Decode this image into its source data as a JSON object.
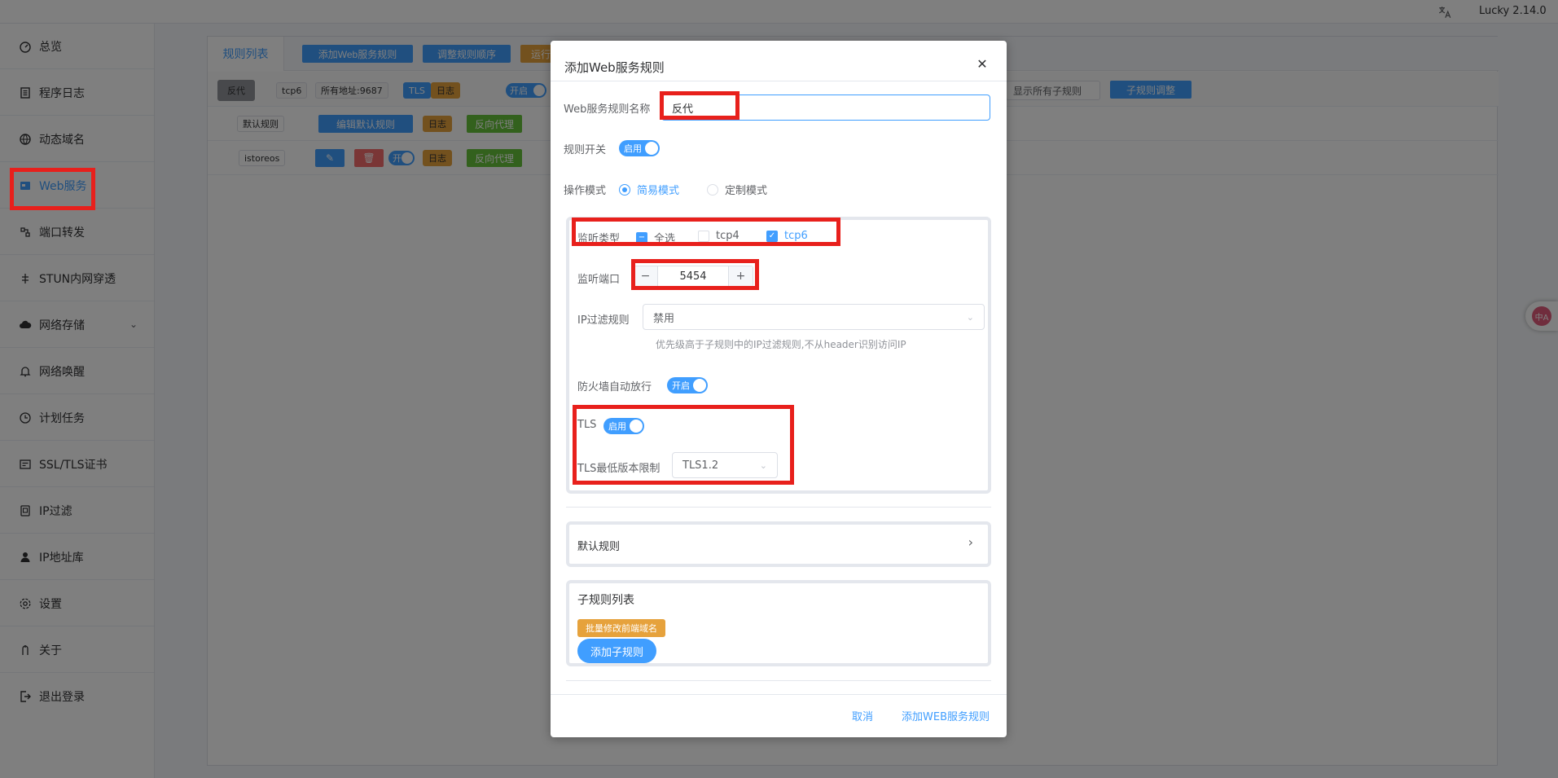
{
  "topbar": {
    "version": "Lucky 2.14.0",
    "lang_icon": "translate-icon"
  },
  "sidebar": {
    "items": [
      {
        "label": "总览",
        "icon": "dashboard-icon"
      },
      {
        "label": "程序日志",
        "icon": "log-icon"
      },
      {
        "label": "动态域名",
        "icon": "ddns-icon"
      },
      {
        "label": "Web服务",
        "icon": "web-service-icon",
        "active": true
      },
      {
        "label": "端口转发",
        "icon": "port-forward-icon"
      },
      {
        "label": "STUN内网穿透",
        "icon": "stun-icon"
      },
      {
        "label": "网络存储",
        "icon": "cloud-storage-icon",
        "has_children": true
      },
      {
        "label": "网络唤醒",
        "icon": "bell-icon"
      },
      {
        "label": "计划任务",
        "icon": "clock-icon"
      },
      {
        "label": "SSL/TLS证书",
        "icon": "certificate-icon"
      },
      {
        "label": "IP过滤",
        "icon": "filter-icon"
      },
      {
        "label": "IP地址库",
        "icon": "user-location-icon"
      },
      {
        "label": "设置",
        "icon": "gear-icon"
      },
      {
        "label": "关于",
        "icon": "about-icon"
      },
      {
        "label": "退出登录",
        "icon": "logout-icon"
      }
    ]
  },
  "background": {
    "tab_active": "规则列表",
    "toolbar": {
      "add_rule": "添加Web服务规则",
      "reorder": "调整规则顺序",
      "run": "运行"
    },
    "rule_row": {
      "name": "反代",
      "tags": [
        "tcp6",
        "所有地址:9687",
        "TLS",
        "日志"
      ],
      "switch": "开启",
      "show_all": "显示所有子规则",
      "sub_adjust": "子规则调整"
    },
    "default_row": {
      "name": "默认规则",
      "edit": "编辑默认规则",
      "log": "日志",
      "proxy": "反向代理"
    },
    "sub_row": {
      "name": "istoreos",
      "switch": "开",
      "log": "日志",
      "proxy": "反向代理"
    }
  },
  "dialog": {
    "title": "添加Web服务规则",
    "name_label": "Web服务规则名称",
    "name_value": "反代",
    "rule_switch_label": "规则开关",
    "rule_switch_text": "启用",
    "mode_label": "操作模式",
    "mode_simple": "简易模式",
    "mode_custom": "定制模式",
    "listen_type_label": "监听类型",
    "listen_all": "全选",
    "listen_tcp4": "tcp4",
    "listen_tcp6": "tcp6",
    "listen_port_label": "监听端口",
    "listen_port_value": "5454",
    "ip_filter_label": "IP过滤规则",
    "ip_filter_value": "禁用",
    "ip_filter_hint": "优先级高于子规则中的IP过滤规则,不从header识别访问IP",
    "firewall_label": "防火墙自动放行",
    "firewall_switch_text": "开启",
    "tls_label": "TLS",
    "tls_switch_text": "启用",
    "tls_min_label": "TLS最低版本限制",
    "tls_min_value": "TLS1.2",
    "default_rule_label": "默认规则",
    "sub_rules_title": "子规则列表",
    "batch_edit": "批量修改前端域名",
    "add_sub_rule": "添加子规则",
    "cancel": "取消",
    "submit": "添加WEB服务规则"
  },
  "colors": {
    "primary": "#409eff",
    "warning": "#e6a23c",
    "success": "#67c23a",
    "highlight": "#e8201c"
  }
}
